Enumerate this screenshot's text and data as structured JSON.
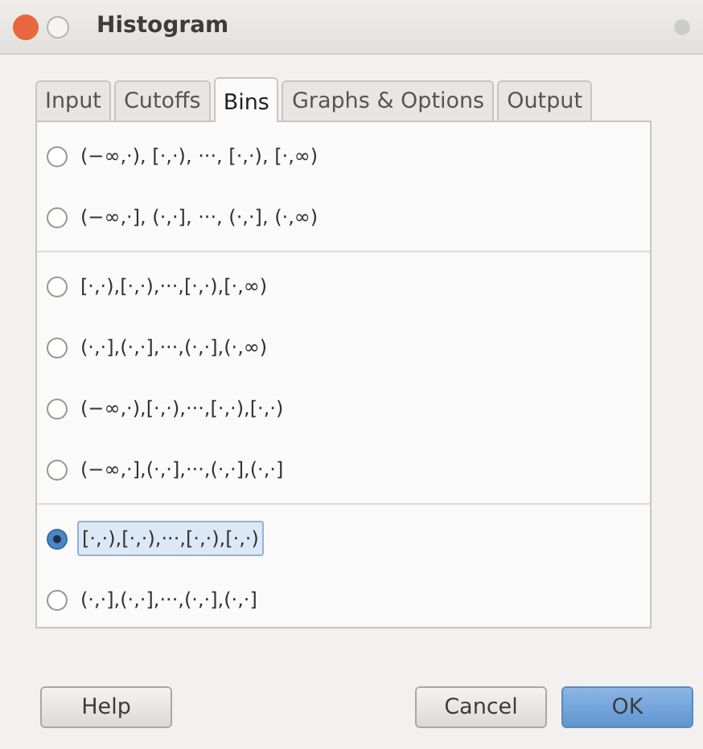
{
  "window": {
    "title": "Histogram"
  },
  "tabs": [
    {
      "label": "Input",
      "selected": false
    },
    {
      "label": "Cutoffs",
      "selected": false
    },
    {
      "label": "Bins",
      "selected": true
    },
    {
      "label": "Graphs & Options",
      "selected": false
    },
    {
      "label": "Output",
      "selected": false
    }
  ],
  "groups": [
    {
      "options": [
        {
          "label": "(−∞,·), [·,·), ···, [·,·), [·,∞)",
          "selected": false,
          "focused": false
        },
        {
          "label": "(−∞,·], (·,·], ···, (·,·], (·,∞)",
          "selected": false,
          "focused": false
        }
      ]
    },
    {
      "options": [
        {
          "label": "[·,·),[·,·),···,[·,·),[·,∞)",
          "selected": false,
          "focused": false
        },
        {
          "label": "(·,·],(·,·],···,(·,·],(·,∞)",
          "selected": false,
          "focused": false
        },
        {
          "label": "(−∞,·),[·,·),···,[·,·),[·,·)",
          "selected": false,
          "focused": false
        },
        {
          "label": "(−∞,·],(·,·],···,(·,·],(·,·]",
          "selected": false,
          "focused": false
        }
      ]
    },
    {
      "options": [
        {
          "label": "[·,·),[·,·),···,[·,·),[·,·)",
          "selected": true,
          "focused": true
        },
        {
          "label": "(·,·],(·,·],···,(·,·],(·,·]",
          "selected": false,
          "focused": false
        }
      ]
    }
  ],
  "buttons": [
    {
      "label": "Help",
      "kind": "help"
    },
    {
      "label": "Cancel",
      "kind": "cancel"
    },
    {
      "label": "OK",
      "kind": "ok"
    }
  ]
}
